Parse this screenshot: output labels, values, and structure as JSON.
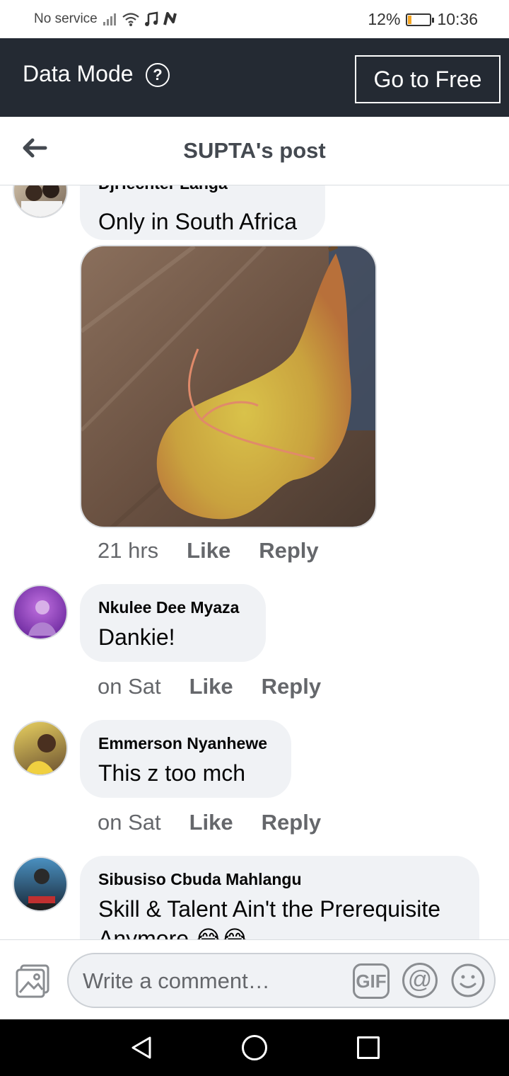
{
  "status_bar": {
    "carrier": "No service",
    "battery": "12%",
    "battery_level": 0.12,
    "time": "10:36"
  },
  "data_mode": {
    "label": "Data Mode",
    "help_icon": "?",
    "go_free": "Go to Free"
  },
  "header": {
    "title": "SUPTA's post",
    "back_icon": "arrow-left-icon"
  },
  "comments": [
    {
      "author": "DjHechter Langa",
      "text": "Only in South Africa",
      "time": "21 hrs",
      "like": "Like",
      "reply": "Reply",
      "has_image": true
    },
    {
      "author": "Nkulee Dee Myaza",
      "text": "Dankie!",
      "time": "on Sat",
      "like": "Like",
      "reply": "Reply"
    },
    {
      "author": "Emmerson Nyanhewe",
      "text": "This z too mch",
      "time": "on Sat",
      "like": "Like",
      "reply": "Reply"
    },
    {
      "author": "Sibusiso Cbuda Mahlangu",
      "text": "Skill & Talent Ain't the Prerequisite",
      "text_line2": "Anymore 😂😂",
      "time": "",
      "like": "",
      "reply": ""
    }
  ],
  "composer": {
    "placeholder": "Write a comment…",
    "gif": "GIF",
    "at": "@"
  },
  "colors": {
    "data_mode_bg": "#242a33",
    "bubble_bg": "#f0f2f5",
    "meta_text": "#65676b"
  }
}
